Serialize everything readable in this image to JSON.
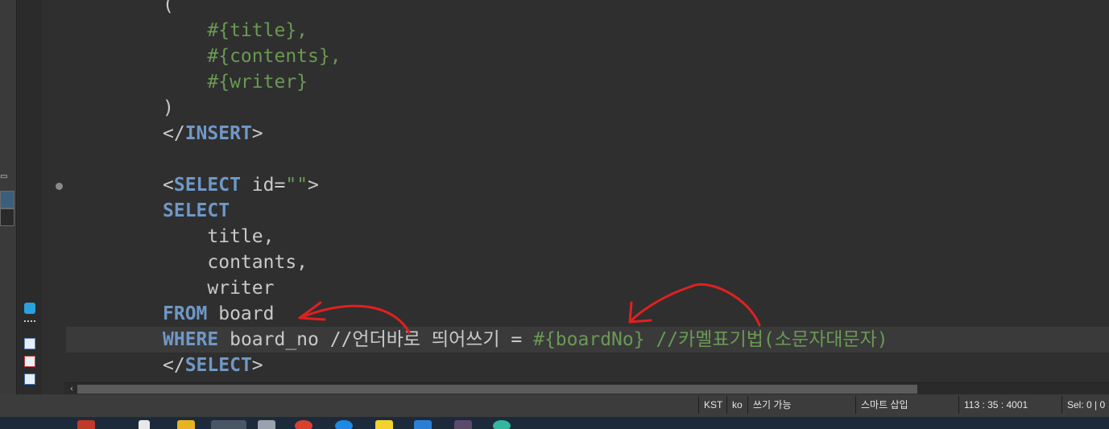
{
  "editor": {
    "lines": [
      {
        "tokens": [
          {
            "t": "(",
            "c": "plain"
          }
        ]
      },
      {
        "tokens": [
          {
            "t": "    #{title},",
            "c": "ph"
          }
        ]
      },
      {
        "tokens": [
          {
            "t": "    #{contents},",
            "c": "ph"
          }
        ]
      },
      {
        "tokens": [
          {
            "t": "    #{writer}",
            "c": "ph"
          }
        ]
      },
      {
        "tokens": [
          {
            "t": ")",
            "c": "plain"
          }
        ]
      },
      {
        "tokens": [
          {
            "t": "</",
            "c": "plain"
          },
          {
            "t": "INSERT",
            "c": "kw"
          },
          {
            "t": ">",
            "c": "plain"
          }
        ]
      },
      {
        "tokens": []
      },
      {
        "tokens": [
          {
            "t": "<",
            "c": "plain"
          },
          {
            "t": "SELECT",
            "c": "kw"
          },
          {
            "t": " id=",
            "c": "plain"
          },
          {
            "t": "\"\"",
            "c": "str"
          },
          {
            "t": ">",
            "c": "plain"
          }
        ]
      },
      {
        "tokens": [
          {
            "t": "SELECT",
            "c": "kw"
          }
        ]
      },
      {
        "tokens": [
          {
            "t": "    title,",
            "c": "plain"
          }
        ]
      },
      {
        "tokens": [
          {
            "t": "    contants,",
            "c": "plain"
          }
        ]
      },
      {
        "tokens": [
          {
            "t": "    writer",
            "c": "plain"
          }
        ]
      },
      {
        "tokens": [
          {
            "t": "FROM",
            "c": "kw"
          },
          {
            "t": " board",
            "c": "plain"
          }
        ]
      },
      {
        "tokens": [
          {
            "t": "WHERE",
            "c": "kw"
          },
          {
            "t": " board_no //",
            "c": "plain"
          },
          {
            "t": "언더바로 띄어쓰기",
            "c": "plain"
          },
          {
            "t": " = ",
            "c": "plain"
          },
          {
            "t": "#{boardNo}",
            "c": "ph"
          },
          {
            "t": " //카멜표기법(소문자대문자)",
            "c": "cmt"
          }
        ],
        "current": true
      },
      {
        "tokens": [
          {
            "t": "</",
            "c": "plain"
          },
          {
            "t": "SELECT",
            "c": "kw"
          },
          {
            "t": ">",
            "c": "plain"
          }
        ]
      }
    ]
  },
  "status": {
    "timezone": "KST",
    "lang": "ko",
    "write_mode": "쓰기 가능",
    "insert_mode": "스마트 삽입",
    "position": "113 : 35 : 4001",
    "selection": "Sel: 0 | 0"
  },
  "icons": {
    "fold_marker": "collapse-dot-icon",
    "scroll_left": "chevron-left-icon"
  },
  "colors": {
    "keyword": "#6f98c7",
    "string": "#6a9955",
    "plain": "#c9c9c9",
    "background": "#2f2f2f",
    "annotation": "#e02020"
  }
}
